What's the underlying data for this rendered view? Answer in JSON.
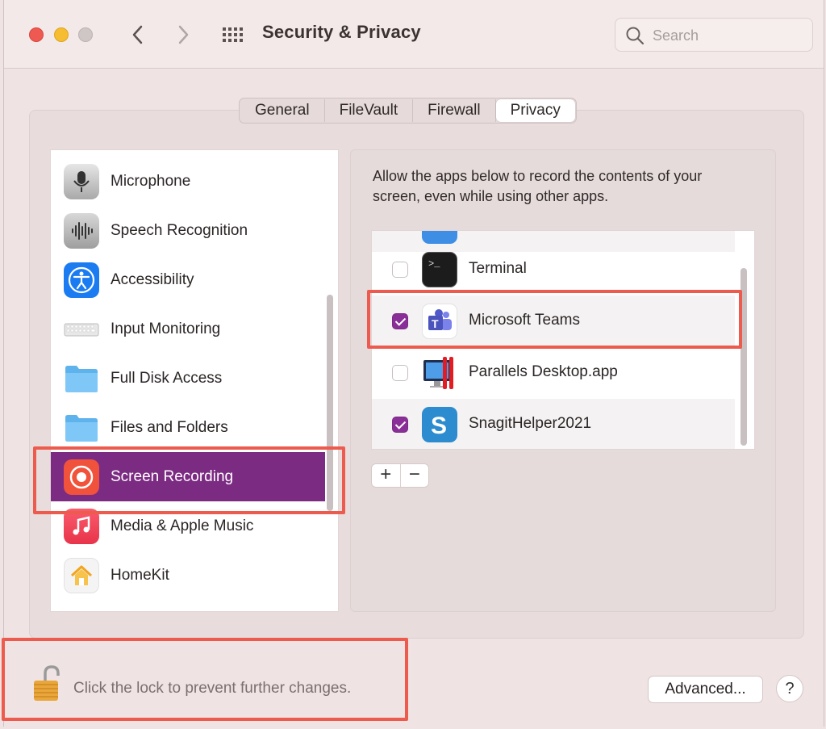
{
  "window": {
    "title": "Security & Privacy",
    "search_placeholder": "Search"
  },
  "tabs": [
    {
      "label": "General",
      "active": false
    },
    {
      "label": "FileVault",
      "active": false
    },
    {
      "label": "Firewall",
      "active": false
    },
    {
      "label": "Privacy",
      "active": true
    }
  ],
  "sidebar": {
    "items": [
      {
        "label": "Microphone",
        "icon": "microphone-icon"
      },
      {
        "label": "Speech Recognition",
        "icon": "waveform-icon"
      },
      {
        "label": "Accessibility",
        "icon": "accessibility-icon"
      },
      {
        "label": "Input Monitoring",
        "icon": "keyboard-icon"
      },
      {
        "label": "Full Disk Access",
        "icon": "folder-icon"
      },
      {
        "label": "Files and Folders",
        "icon": "folder-icon"
      },
      {
        "label": "Screen Recording",
        "icon": "record-icon",
        "selected": true
      },
      {
        "label": "Media & Apple Music",
        "icon": "music-icon"
      },
      {
        "label": "HomeKit",
        "icon": "home-icon"
      }
    ]
  },
  "main": {
    "description": "Allow the apps below to record the contents of your screen, even while using other apps.",
    "apps": [
      {
        "name": "Terminal",
        "checked": false,
        "icon": "terminal-icon"
      },
      {
        "name": "Microsoft Teams",
        "checked": true,
        "icon": "teams-icon"
      },
      {
        "name": "Parallels Desktop.app",
        "checked": false,
        "icon": "parallels-icon"
      },
      {
        "name": "SnagitHelper2021",
        "checked": true,
        "icon": "snagit-icon"
      }
    ],
    "add_label": "+",
    "remove_label": "−"
  },
  "footer": {
    "lock_text": "Click the lock to prevent further changes.",
    "advanced_label": "Advanced...",
    "help_label": "?"
  },
  "colors": {
    "selection": "#7c2b83",
    "checkbox_on": "#8a2f97",
    "highlight": "#ec5b4e"
  }
}
